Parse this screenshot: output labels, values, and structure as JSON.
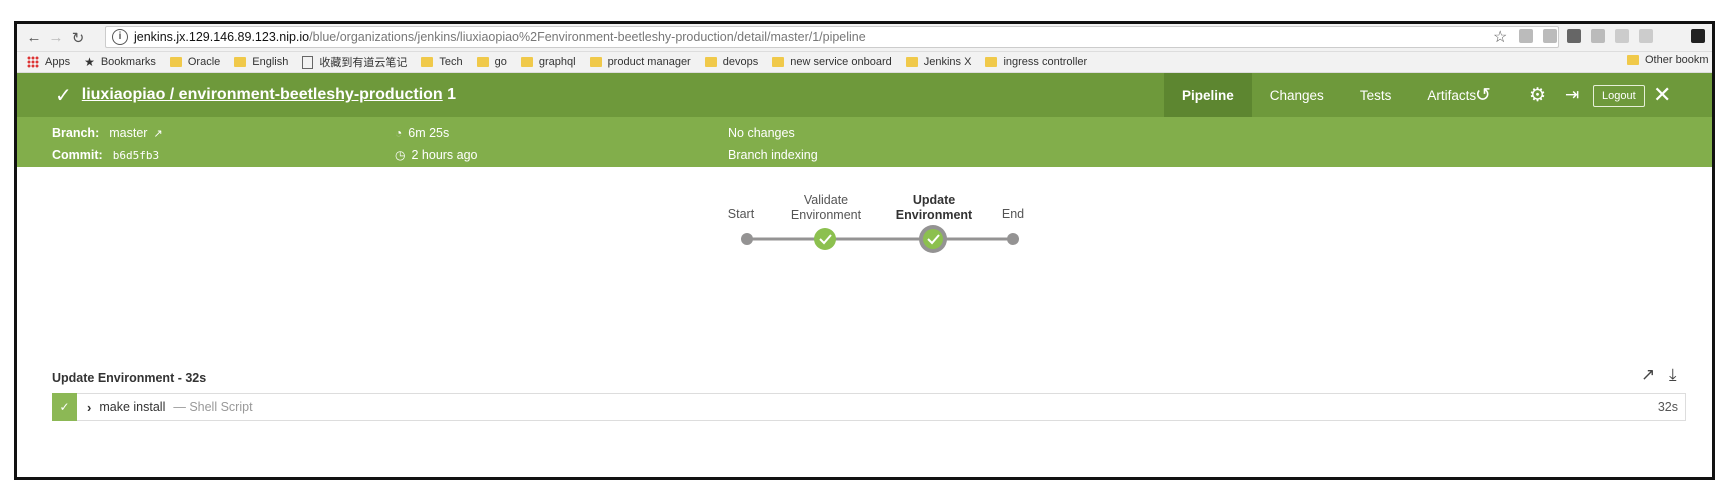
{
  "browser": {
    "url_host": "jenkins.jx.129.146.89.123.nip.io",
    "url_path": "/blue/organizations/jenkins/liuxiaopiao%2Fenvironment-beetleshy-production/detail/master/1/pipeline",
    "bookmarks": [
      "Apps",
      "Bookmarks",
      "Oracle",
      "English",
      "收藏到有道云笔记",
      "Tech",
      "go",
      "graphql",
      "product manager",
      "devops",
      "new service onboard",
      "Jenkins X",
      "ingress controller"
    ],
    "other_bookmarks": "Other bookm"
  },
  "header": {
    "title_link": "liuxiaopiao / environment-beetleshy-production",
    "run_number": "1",
    "tabs": [
      "Pipeline",
      "Changes",
      "Tests",
      "Artifacts"
    ],
    "active_tab": "Pipeline",
    "logout_label": "Logout",
    "accent": "#6e993b"
  },
  "info": {
    "branch_label": "Branch:",
    "branch_value": "master",
    "commit_label": "Commit:",
    "commit_value": "b6d5fb3",
    "duration": "6m 25s",
    "time_ago": "2 hours ago",
    "changes": "No changes",
    "cause": "Branch indexing"
  },
  "pipeline": {
    "stages": [
      {
        "line1": "",
        "line2": "Start",
        "status": "start"
      },
      {
        "line1": "Validate",
        "line2": "Environment",
        "status": "success"
      },
      {
        "line1": "Update",
        "line2": "Environment",
        "status": "selected-success"
      },
      {
        "line1": "",
        "line2": "End",
        "status": "end"
      }
    ]
  },
  "steps": {
    "title": "Update Environment - 32s",
    "items": [
      {
        "name": "make install",
        "type": "— Shell Script",
        "duration": "32s",
        "status": "success"
      }
    ]
  }
}
